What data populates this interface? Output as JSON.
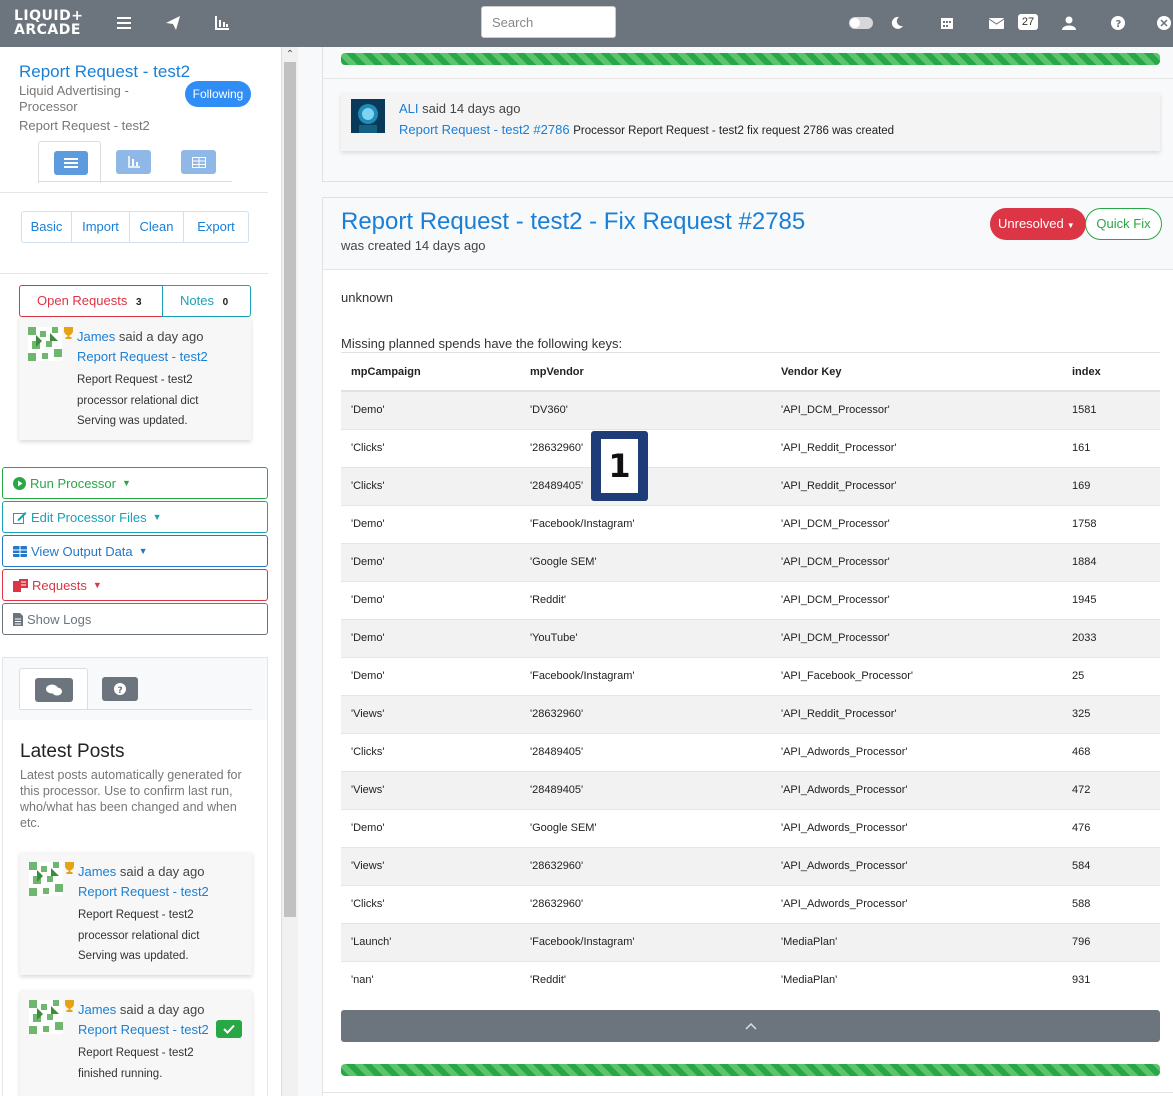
{
  "topbar": {
    "logo_line1": "LIQUID+",
    "logo_line2": "ARCADE",
    "search_placeholder": "Search",
    "messages_count": "27"
  },
  "sidebar": {
    "title": "Report Request - test2",
    "subtitle1": "Liquid Advertising -",
    "subtitle2": "Processor",
    "subtitle3": "Report Request - test2",
    "following": "Following",
    "nav_buttons": [
      "Basic",
      "Import",
      "Clean",
      "Export"
    ],
    "tabs": {
      "open_requests": "Open Requests",
      "open_requests_count": "3",
      "notes": "Notes",
      "notes_count": "0"
    },
    "open_post": {
      "author": "James",
      "said": "said a day ago",
      "link": "Report Request - test2",
      "line1": "Report Request - test2",
      "line2": "processor relational dict",
      "line3": "Serving was updated."
    },
    "actions": [
      "Run Processor",
      "Edit Processor Files",
      "View Output Data",
      "Requests",
      "Show Logs"
    ],
    "latest_title": "Latest Posts",
    "latest_desc": "Latest posts automatically generated for this processor. Use to confirm last run, who/what has been changed and when etc.",
    "posts": [
      {
        "author": "James",
        "said": "said a day ago",
        "link": "Report Request - test2",
        "line1": "Report Request - test2",
        "line2": "processor relational dict",
        "line3": "Serving was updated."
      },
      {
        "author": "James",
        "said": "said a day ago",
        "link": "Report Request - test2",
        "line1": "Report Request - test2",
        "line2": "finished running."
      }
    ]
  },
  "main": {
    "note": {
      "author": "ALI",
      "said": "said 14 days ago",
      "link": "Report Request - test2 #2786",
      "text": "Processor Report Request - test2 fix request 2786 was created"
    },
    "request": {
      "title": "Report Request - test2 - Fix Request #2785",
      "created": "was created 14 days ago",
      "status": "Unresolved",
      "quick_fix": "Quick Fix",
      "body1": "unknown",
      "body2": "Missing planned spends have the following keys:"
    },
    "table": {
      "headers": [
        "mpCampaign",
        "mpVendor",
        "Vendor Key",
        "index"
      ],
      "rows": [
        [
          "'Demo'",
          "'DV360'",
          "'API_DCM_Processor'",
          "1581"
        ],
        [
          "'Clicks'",
          "'28632960'",
          "'API_Reddit_Processor'",
          "161"
        ],
        [
          "'Clicks'",
          "'28489405'",
          "'API_Reddit_Processor'",
          "169"
        ],
        [
          "'Demo'",
          "'Facebook/Instagram'",
          "'API_DCM_Processor'",
          "1758"
        ],
        [
          "'Demo'",
          "'Google SEM'",
          "'API_DCM_Processor'",
          "1884"
        ],
        [
          "'Demo'",
          "'Reddit'",
          "'API_DCM_Processor'",
          "1945"
        ],
        [
          "'Demo'",
          "'YouTube'",
          "'API_DCM_Processor'",
          "2033"
        ],
        [
          "'Demo'",
          "'Facebook/Instagram'",
          "'API_Facebook_Processor'",
          "25"
        ],
        [
          "'Views'",
          "'28632960'",
          "'API_Reddit_Processor'",
          "325"
        ],
        [
          "'Clicks'",
          "'28489405'",
          "'API_Adwords_Processor'",
          "468"
        ],
        [
          "'Views'",
          "'28489405'",
          "'API_Adwords_Processor'",
          "472"
        ],
        [
          "'Demo'",
          "'Google SEM'",
          "'API_Adwords_Processor'",
          "476"
        ],
        [
          "'Views'",
          "'28632960'",
          "'API_Adwords_Processor'",
          "584"
        ],
        [
          "'Clicks'",
          "'28632960'",
          "'API_Adwords_Processor'",
          "588"
        ],
        [
          "'Launch'",
          "'Facebook/Instagram'",
          "'MediaPlan'",
          "796"
        ],
        [
          "'nan'",
          "'Reddit'",
          "'MediaPlan'",
          "931"
        ]
      ]
    },
    "marker": "1"
  },
  "colors": {
    "topbar": "#6c757d",
    "link": "#1a7fd6",
    "danger": "#dc3545",
    "success": "#28a745",
    "info": "#17a2b8",
    "primary": "#007bff"
  }
}
